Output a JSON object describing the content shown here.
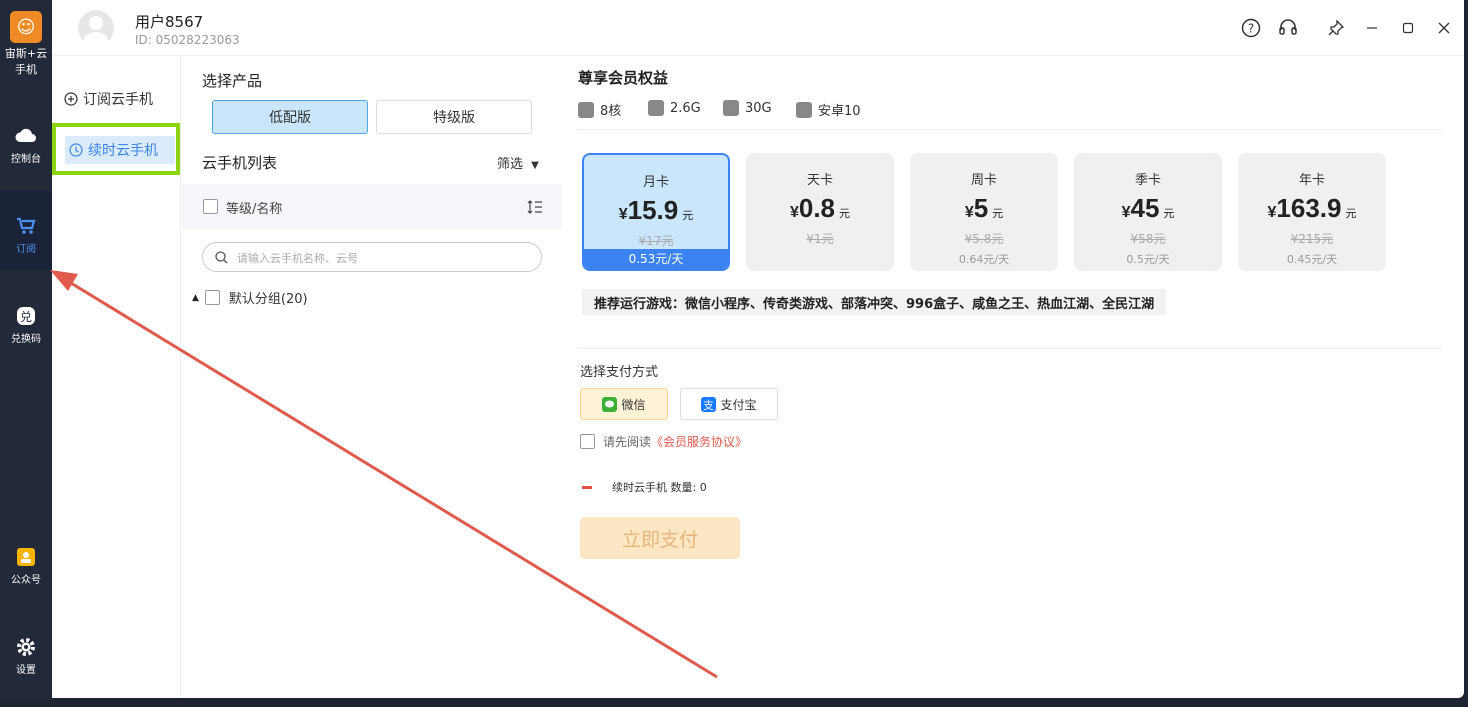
{
  "app": {
    "logo_text_line1": "宙斯+云",
    "logo_text_line2": "手机"
  },
  "leftnav": {
    "items": [
      {
        "label": "控制台",
        "icon": "cloud-icon"
      },
      {
        "label": "订阅",
        "icon": "cart-icon",
        "active": true
      },
      {
        "label": "兑换码",
        "icon": "exchange-icon"
      },
      {
        "label": "公众号",
        "icon": "official-account-icon"
      },
      {
        "label": "设置",
        "icon": "gear-icon"
      }
    ]
  },
  "topbar": {
    "username": "用户8567",
    "user_id": "ID: 05028223063",
    "icons": [
      "help-icon",
      "headset-icon",
      "pin-icon",
      "minimize-icon",
      "maximize-icon",
      "close-icon"
    ]
  },
  "submenu": {
    "items": [
      {
        "label": "订阅云手机",
        "icon": "plus-circle-icon"
      },
      {
        "label": "续时云手机",
        "icon": "renew-icon",
        "active": true
      }
    ]
  },
  "product": {
    "title": "选择产品",
    "versions": [
      "低配版",
      "特级版"
    ],
    "selected_version": "低配版",
    "list_title": "云手机列表",
    "filter_label": "筛选",
    "column_header": "等级/名称",
    "search_placeholder": "请输入云手机名称、云号",
    "group_label": "默认分组(20)"
  },
  "benefits": {
    "title": "尊享会员权益",
    "specs": [
      {
        "icon": "cpu-icon",
        "label": "8核"
      },
      {
        "icon": "chip-icon",
        "label": "2.6G"
      },
      {
        "icon": "storage-icon",
        "label": "30G"
      },
      {
        "icon": "android-icon",
        "label": "安卓10"
      }
    ]
  },
  "plans": [
    {
      "name": "月卡",
      "currency": "¥",
      "price": "15.9",
      "unit": "元",
      "original": "¥17元",
      "per_day": "0.53元/天",
      "selected": true
    },
    {
      "name": "天卡",
      "currency": "¥",
      "price": "0.8",
      "unit": "元",
      "original": "¥1元",
      "per_day": "",
      "selected": false
    },
    {
      "name": "周卡",
      "currency": "¥",
      "price": "5",
      "unit": "元",
      "original": "¥5.8元",
      "per_day": "0.64元/天",
      "selected": false
    },
    {
      "name": "季卡",
      "currency": "¥",
      "price": "45",
      "unit": "元",
      "original": "¥58元",
      "per_day": "0.5元/天",
      "selected": false
    },
    {
      "name": "年卡",
      "currency": "¥",
      "price": "163.9",
      "unit": "元",
      "original": "¥215元",
      "per_day": "0.45元/天",
      "selected": false
    }
  ],
  "recommend": "推荐运行游戏：微信小程序、传奇类游戏、部落冲突、996盒子、咸鱼之王、热血江湖、全民江湖",
  "payment": {
    "title": "选择支付方式",
    "methods": [
      {
        "label": "微信",
        "icon": "wechat-icon",
        "selected": true
      },
      {
        "label": "支付宝",
        "icon": "alipay-icon",
        "selected": false
      }
    ],
    "agree_prefix": "请先阅读",
    "agree_link": "《会员服务协议》",
    "quantity_text": "续时云手机 数量: 0",
    "pay_button": "立即支付"
  },
  "colors": {
    "accent": "#3b83f0",
    "highlight_box": "#8cd411",
    "arrow": "#e05a4c"
  }
}
